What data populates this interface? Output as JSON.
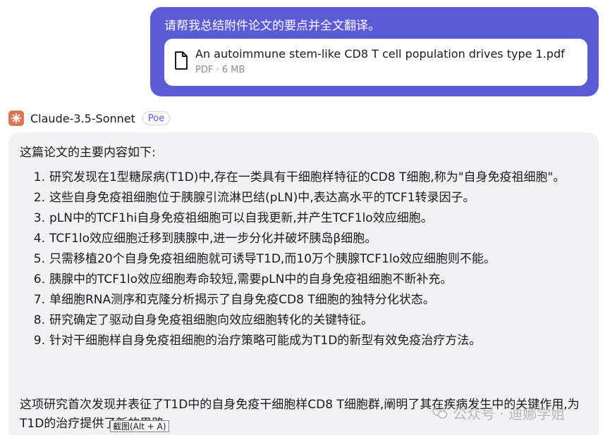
{
  "user_message": {
    "text": "请帮我总结附件论文的要点并全文翻译。",
    "attachment": {
      "file_name": "An autoimmune stem-like CD8 T cell population drives type 1.pdf",
      "meta": "PDF · 6 MB",
      "icon": "document-icon"
    }
  },
  "bot": {
    "name": "Claude-3.5-Sonnet",
    "badge": "Poe",
    "avatar_icon": "claude-sparkle-icon",
    "avatar_color": "#d97757"
  },
  "response": {
    "intro": "这篇论文的主要内容如下:",
    "points": [
      {
        "num": "1.",
        "text": "研究发现在1型糖尿病(T1D)中,存在一类具有干细胞样特征的CD8 T细胞,称为\"自身免疫祖细胞\"。"
      },
      {
        "num": "2.",
        "text": "这些自身免疫祖细胞位于胰腺引流淋巴结(pLN)中,表达高水平的TCF1转录因子。"
      },
      {
        "num": "3.",
        "text": "pLN中的TCF1hi自身免疫祖细胞可以自我更新,并产生TCF1lo效应细胞。"
      },
      {
        "num": "4.",
        "text": "TCF1lo效应细胞迁移到胰腺中,进一步分化并破坏胰岛β细胞。"
      },
      {
        "num": "5.",
        "text": "只需移植20个自身免疫祖细胞就可诱导T1D,而10万个胰腺TCF1lo效应细胞则不能。"
      },
      {
        "num": "6.",
        "text": "胰腺中的TCF1lo效应细胞寿命较短,需要pLN中的自身免疫祖细胞不断补充。"
      },
      {
        "num": "7.",
        "text": "单细胞RNA测序和克隆分析揭示了自身免疫CD8 T细胞的独特分化状态。"
      },
      {
        "num": "8.",
        "text": "研究确定了驱动自身免疫祖细胞向效应细胞转化的关键特征。"
      },
      {
        "num": "9.",
        "text": "针对干细胞样自身免疫祖细胞的治疗策略可能成为T1D的新型有效免疫治疗方法。"
      }
    ],
    "summary": "这项研究首次发现并表征了T1D中的自身免疫干细胞样CD8 T细胞群,阐明了其在疾病发生中的关键作用,为T1D的治疗提供了新的思路。"
  },
  "tooltip": {
    "text": "截图(Alt + A)"
  },
  "watermark": {
    "text": "公众号 · 迪娜学姐",
    "icon": "wechat-icon"
  },
  "colors": {
    "user_bubble": "#5b5bd6",
    "bot_bubble": "#f2f2f5",
    "accent": "#5b5bd6"
  }
}
